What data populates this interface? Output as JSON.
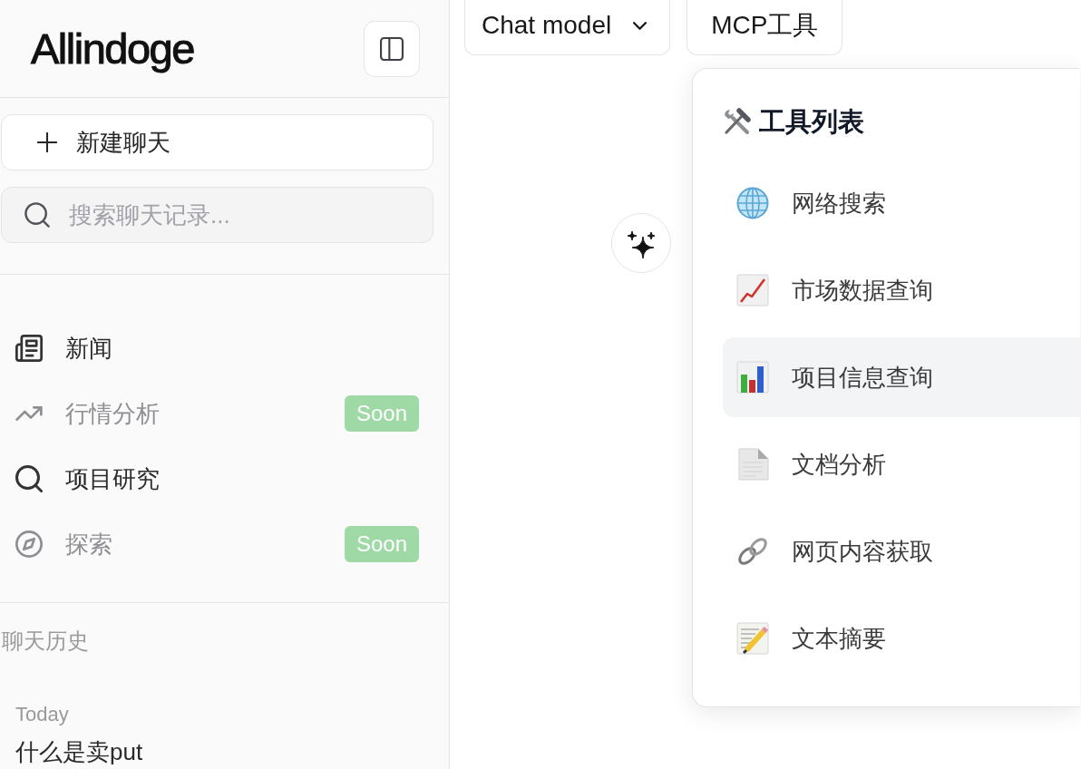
{
  "sidebar": {
    "logo": "Allindoge",
    "new_chat_button": "新建聊天",
    "search": {
      "placeholder": "搜索聊天记录..."
    },
    "nav_items": [
      {
        "label": "新闻",
        "disabled": false
      },
      {
        "label": "行情分析",
        "disabled": true,
        "badge": "Soon"
      },
      {
        "label": "项目研究",
        "disabled": false
      },
      {
        "label": "探索",
        "disabled": true,
        "badge": "Soon"
      }
    ],
    "history": {
      "heading": "聊天历史",
      "groups": [
        {
          "label": "Today",
          "chats": [
            "什么是卖put"
          ]
        }
      ]
    }
  },
  "toolbar": {
    "model_selector": "Chat model",
    "mcp_button": "MCP工具"
  },
  "tools_panel": {
    "title": "工具列表",
    "tools": [
      {
        "label": "网络搜索",
        "selected": false
      },
      {
        "label": "市场数据查询",
        "selected": false
      },
      {
        "label": "项目信息查询",
        "selected": true
      },
      {
        "label": "文档分析",
        "selected": false
      },
      {
        "label": "网页内容获取",
        "selected": false
      },
      {
        "label": "文本摘要",
        "selected": false
      }
    ]
  }
}
